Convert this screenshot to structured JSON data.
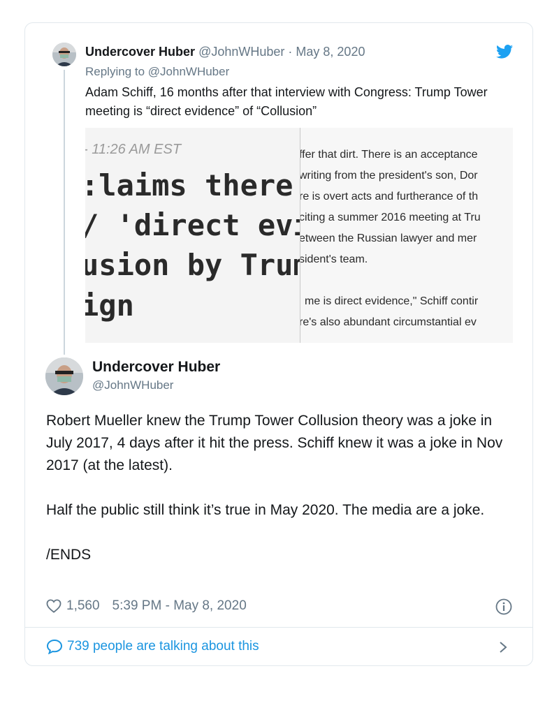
{
  "reply_tweet": {
    "author_name": "Undercover Huber",
    "handle": "@JohnWHuber",
    "date": "· May 8, 2020",
    "replying_to": "Replying to @JohnWHuber",
    "text": "Adam Schiff, 16 months after that interview with Congress: Trump Tower meeting is “direct evidence” of “Collusion”",
    "media": {
      "timestamp": "- 11:26 AM EST",
      "headline_lines": [
        ":laims there's",
        "/ 'direct evide",
        "usion by Trum",
        "ign"
      ],
      "article_lines": [
        "ffer that dirt. There is an acceptance",
        "writing from the president's son, Dor",
        "re is overt acts and furtherance of th",
        "citing a summer 2016 meeting at Tru",
        "etween the Russian lawyer and mer",
        "sident's team.",
        "me is direct evidence,\" Schiff contir",
        "re's also abundant circumstantial ev"
      ]
    }
  },
  "main_tweet": {
    "author_name": "Undercover Huber",
    "handle": "@JohnWHuber",
    "paragraphs": [
      "Robert Mueller knew the Trump Tower Collusion theory was a joke in July 2017, 4 days after it hit the press. Schiff knew it was a joke in Nov 2017 (at the latest).",
      "Half the public still think it’s true in May 2020. The media are a joke.",
      "/ENDS"
    ],
    "likes": "1,560",
    "timestamp": "5:39 PM - May 8, 2020"
  },
  "footer": {
    "talking": "739 people are talking about this"
  },
  "colors": {
    "link_blue": "#1b95e0",
    "twitter_blue": "#1da1f2",
    "gray_text": "#657786",
    "border": "#e1e8ed"
  },
  "icons": [
    "twitter-bird-icon",
    "heart-icon",
    "info-icon",
    "speech-bubble-icon",
    "chevron-right-icon"
  ]
}
